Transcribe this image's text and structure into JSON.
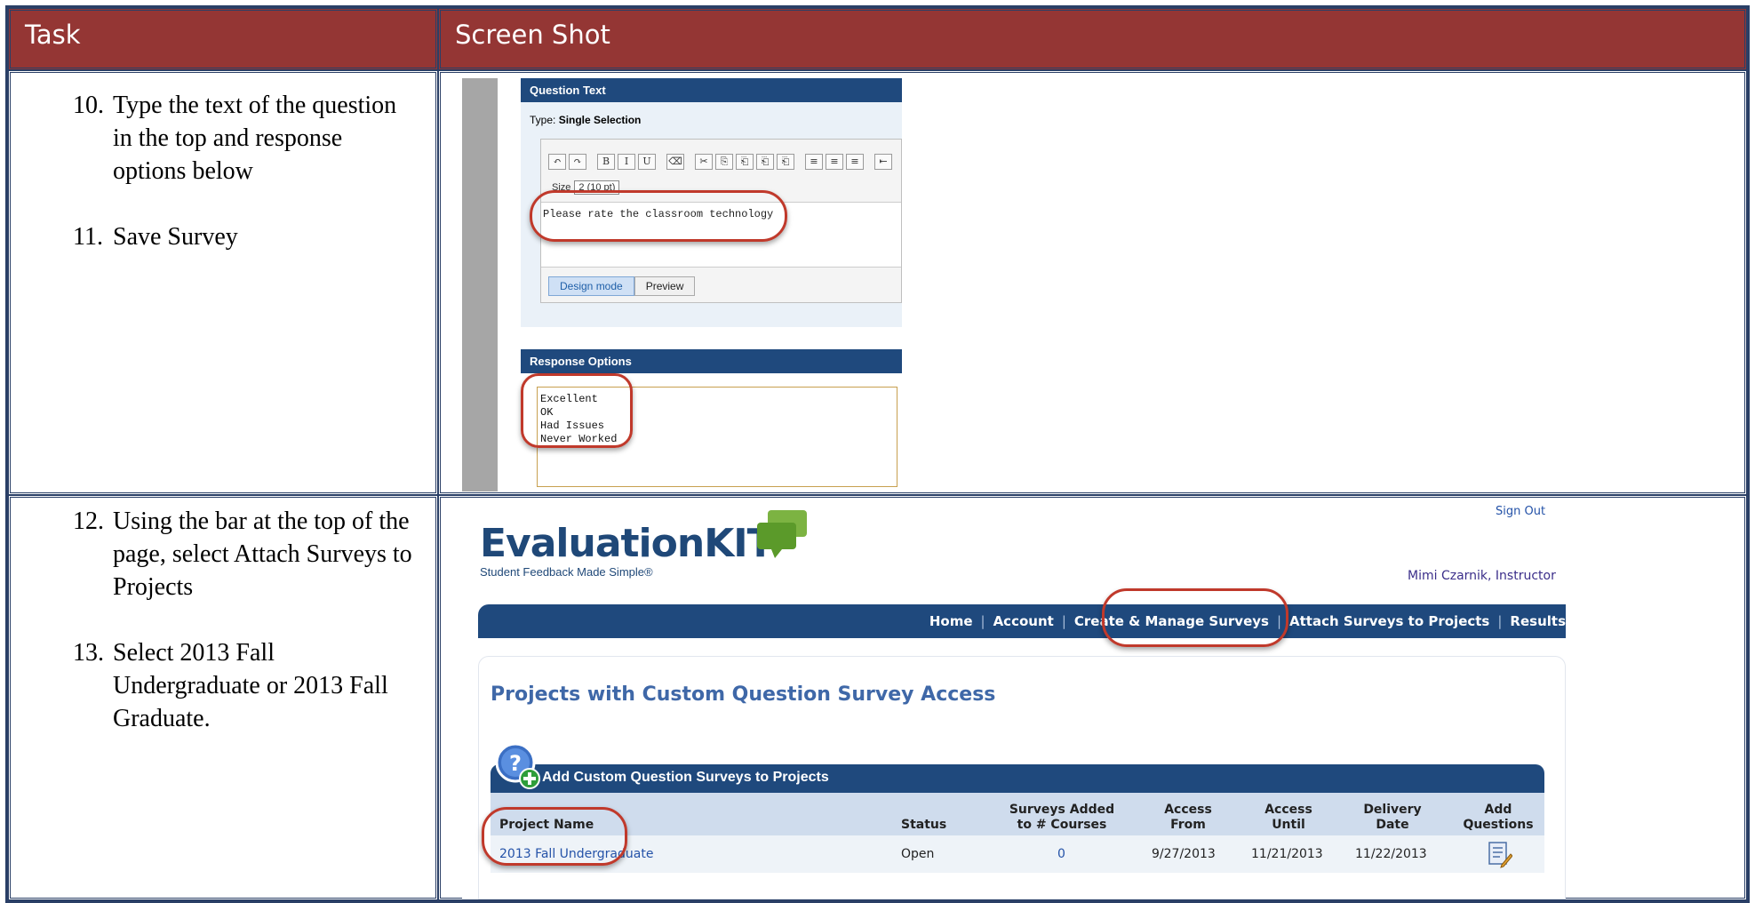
{
  "headers": {
    "task": "Task",
    "screenshot": "Screen Shot"
  },
  "rows": [
    {
      "tasks": [
        {
          "num": "10.",
          "text": "Type the text of the question in the top and response options below"
        },
        {
          "num": "11.",
          "text": "Save  Survey"
        }
      ]
    },
    {
      "tasks": [
        {
          "num": "12.",
          "text": "Using the bar at the top of the page, select Attach Surveys to Projects"
        },
        {
          "num": "13.",
          "text": "Select 2013 Fall Undergraduate or 2013 Fall Graduate."
        }
      ]
    }
  ],
  "editor": {
    "question_section_title": "Question Text",
    "type_label": "Type: ",
    "type_value": "Single Selection",
    "toolbar_buttons": [
      "↶",
      "↷",
      "B",
      "I",
      "U",
      "⌫",
      "✂",
      "⎘",
      "⎗",
      "⎗",
      "⎗",
      "≡",
      "≡",
      "≡",
      "⇤"
    ],
    "size_label": "Size",
    "size_value": "2 (10 pt)",
    "question_text": "Please rate the classroom technology",
    "design_mode_label": "Design mode",
    "preview_label": "Preview",
    "response_section_title": "Response Options",
    "response_options": [
      "Excellent",
      "OK",
      "Had Issues",
      "Never Worked"
    ]
  },
  "evalkit": {
    "logo_text": "EvaluationKIT",
    "tagline": "Student Feedback Made Simple®",
    "sign_out": "Sign Out",
    "user": "Mimi Czarnik, Instructor",
    "nav": [
      "Home",
      "Account",
      "Create & Manage Surveys",
      "Attach Surveys to Projects",
      "Results"
    ],
    "page_title": "Projects with Custom Question Survey Access",
    "panel_title": "Add Custom Question Surveys to Projects",
    "columns": {
      "project_name": "Project Name",
      "status": "Status",
      "surveys_added": "Surveys Added to # Courses",
      "access_from": "Access From",
      "access_until": "Access Until",
      "delivery_date": "Delivery Date",
      "add_questions": "Add Questions"
    },
    "table_rows": [
      {
        "project_name": "2013 Fall Undergraduate",
        "status": "Open",
        "surveys_added": "0",
        "access_from": "9/27/2013",
        "access_until": "11/21/2013",
        "delivery_date": "11/22/2013"
      }
    ],
    "colors": {
      "brand_blue": "#1f497d",
      "header_red": "#943634",
      "highlight_ring": "#c0392b",
      "brand_green": "#7cb342"
    }
  },
  "icons": [
    "help-plus-icon",
    "edit-document-icon",
    "speech-bubble-logo-icon"
  ]
}
